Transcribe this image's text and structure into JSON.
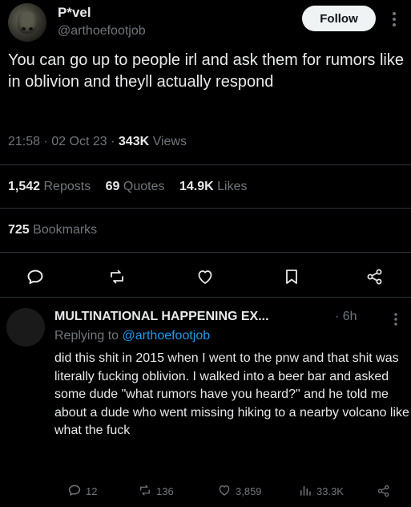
{
  "tweet": {
    "display_name": "P*vel",
    "handle": "@arthoefootjob",
    "follow_label": "Follow",
    "text": "You can go up to people irl and ask them for rumors like in oblivion and theyll actually respond",
    "time": "21:58",
    "sep1": "·",
    "date": "02 Oct 23",
    "sep2": "·",
    "views_count": "343K",
    "views_label": "Views",
    "reposts_count": "1,542",
    "reposts_label": "Reposts",
    "quotes_count": "69",
    "quotes_label": "Quotes",
    "likes_count": "14.9K",
    "likes_label": "Likes",
    "bookmarks_count": "725",
    "bookmarks_label": "Bookmarks"
  },
  "icons": {
    "actions": [
      "reply-icon",
      "repost-icon",
      "like-icon",
      "bookmark-icon",
      "share-icon"
    ],
    "more": "more-vertical-icon"
  },
  "reply": {
    "display_name": "MULTINATIONAL HAPPENING EX...",
    "time_sep": "·",
    "time": "6h",
    "replying_prefix": "Replying to",
    "replying_to": "@arthoefootjob",
    "text": "did this shit in 2015 when I went to the pnw and that shit was literally fucking oblivion. I walked into a beer bar and asked some dude \"what rumors have you heard?\" and he told me about a dude who went missing hiking to a nearby volcano like what the fuck",
    "reply_count": "12",
    "repost_count": "136",
    "like_count": "3,859",
    "views_count": "33.3K"
  },
  "colors": {
    "background": "#000000",
    "text": "#e7e9ea",
    "muted": "#71767b",
    "link": "#1d9bf0",
    "divider": "#2f3336",
    "follow_bg": "#eff3f4"
  }
}
